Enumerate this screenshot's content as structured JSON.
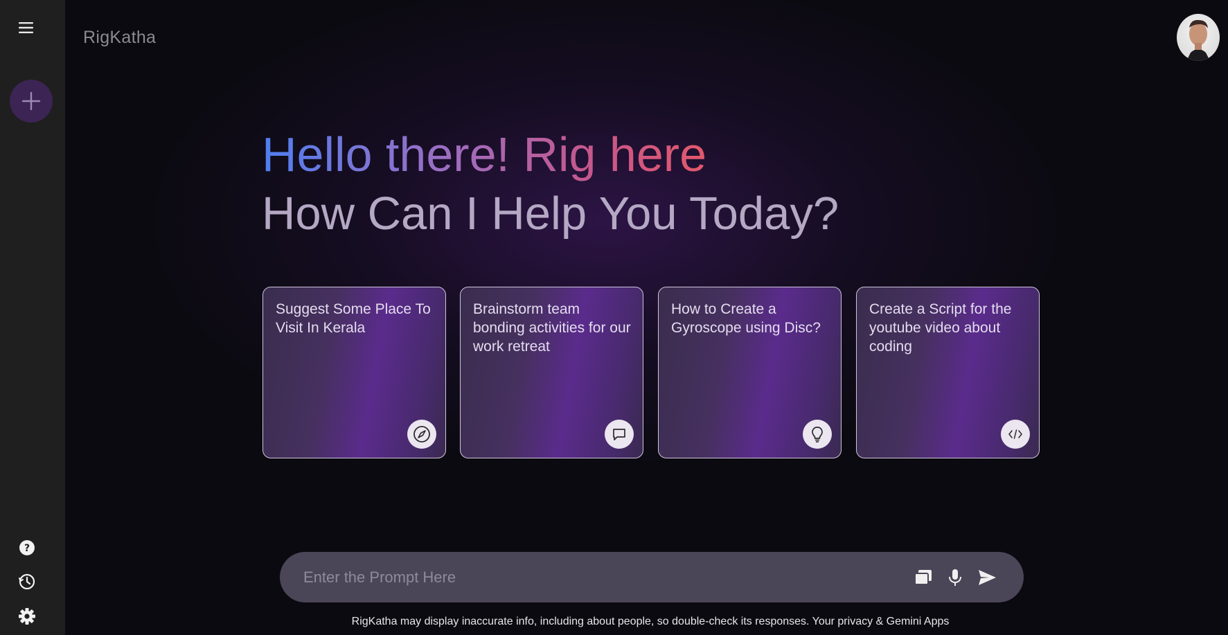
{
  "app": {
    "brand": "RigKatha"
  },
  "greeting": {
    "line1": "Hello there! Rig here",
    "line2": "How Can I Help You Today?"
  },
  "cards": [
    {
      "text": "Suggest Some Place To Visit In Kerala",
      "icon": "compass-icon"
    },
    {
      "text": "Brainstorm team bonding activities for our work retreat",
      "icon": "chat-bubble-icon"
    },
    {
      "text": "How to Create a Gyroscope using Disc?",
      "icon": "lightbulb-icon"
    },
    {
      "text": "Create a Script for the youtube video about coding",
      "icon": "code-icon"
    }
  ],
  "prompt": {
    "placeholder": "Enter the Prompt Here",
    "value": ""
  },
  "sidebar": {
    "top_icons": [
      "menu-icon",
      "plus-icon"
    ],
    "bottom_icons": [
      "help-icon",
      "history-icon",
      "settings-icon"
    ]
  },
  "prompt_icons": [
    "gallery-icon",
    "microphone-icon",
    "send-icon"
  ],
  "footer": {
    "disclaimer": "RigKatha may display inaccurate info, including about people, so double-check its responses. Your privacy & Gemini Apps"
  },
  "colors": {
    "sidebar_bg": "#1f1f1f",
    "page_bg": "#0b0a10",
    "accent": "#3c2455",
    "greeting_gradient": [
      "#4f7ef0",
      "#9a6fc4",
      "#e2586c"
    ],
    "prompt_bar_bg": "#4b4657"
  }
}
